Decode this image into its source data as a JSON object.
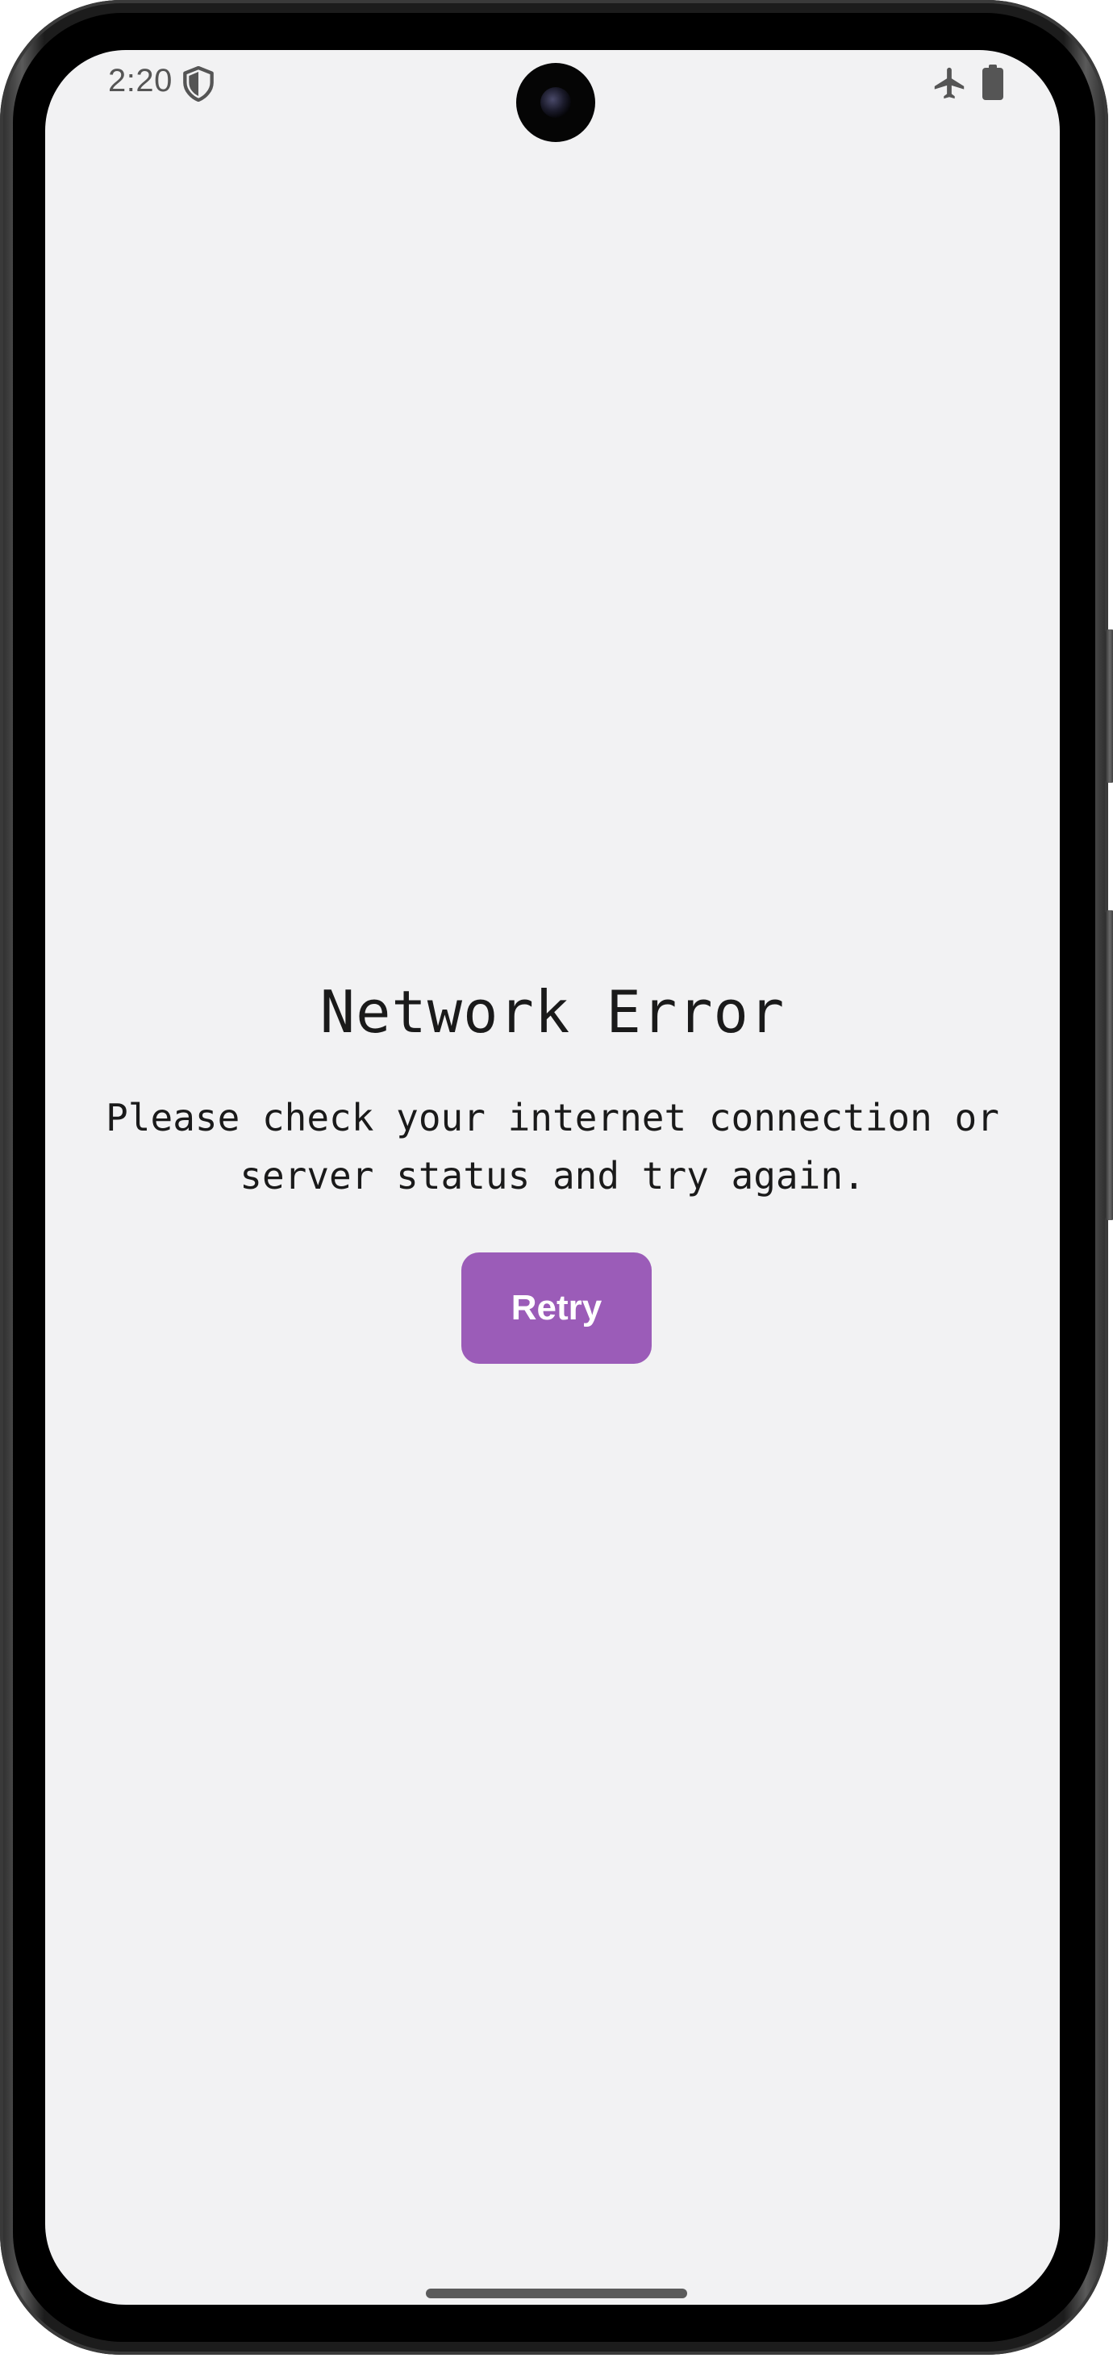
{
  "status_bar": {
    "time": "2:20",
    "icons": [
      "shield-icon",
      "airplane-mode-icon",
      "battery-icon"
    ]
  },
  "error": {
    "title": "Network Error",
    "message": "Please check your internet connection or server status and try again."
  },
  "actions": {
    "retry_label": "Retry"
  },
  "colors": {
    "screen_background": "#f2f2f3",
    "accent_button": "#9b5cb8",
    "text": "#1a1a1a",
    "status_icons": "#555555"
  }
}
